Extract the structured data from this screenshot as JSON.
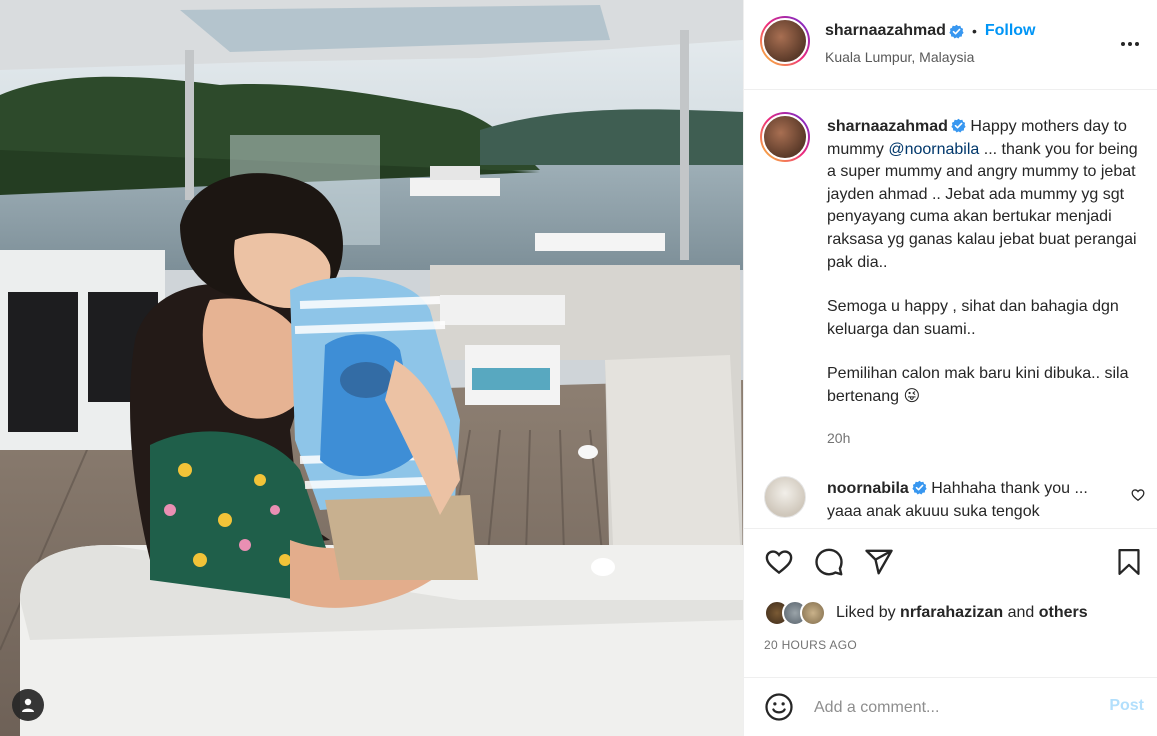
{
  "colors": {
    "accent": "#0095f6",
    "post_disabled": "#b2dffc",
    "verified": "#3897f0",
    "mention": "#00376b"
  },
  "post": {
    "author": {
      "username": "sharnaazahmad",
      "verified": true,
      "location": "Kuala Lumpur, Malaysia"
    },
    "follow_label": "Follow",
    "separator": "•",
    "caption": {
      "text_before_mention": "Happy mothers day to mummy ",
      "mention": "@noornabila",
      "text_after_mention": " ... thank you for being a super mummy and angry mummy to jebat jayden ahmad .. Jebat ada mummy yg sgt penyayang cuma akan bertukar menjadi raksasa yg ganas kalau jebat buat perangai pak dia..",
      "paragraph_2": "Semoga u happy , sihat dan bahagia dgn keluarga dan suami..",
      "paragraph_3": "Pemilihan calon mak baru kini dibuka.. sila bertenang 😜",
      "time": "20h"
    },
    "reply": {
      "username": "noornabila",
      "verified": true,
      "text": "Hahhaha thank you ... yaaa anak akuuu suka tengok"
    },
    "likes": {
      "prefix": "Liked by ",
      "user": "nrfarahazizan",
      "middle": " and ",
      "others": "others"
    },
    "posted_ago": "20 HOURS AGO",
    "comment_box": {
      "placeholder": "Add a comment...",
      "post_label": "Post"
    }
  },
  "icons": [
    "more-options-icon",
    "heart-icon",
    "comment-icon",
    "share-icon",
    "bookmark-icon",
    "emoji-icon",
    "user-tag-icon",
    "verified-badge-icon"
  ]
}
